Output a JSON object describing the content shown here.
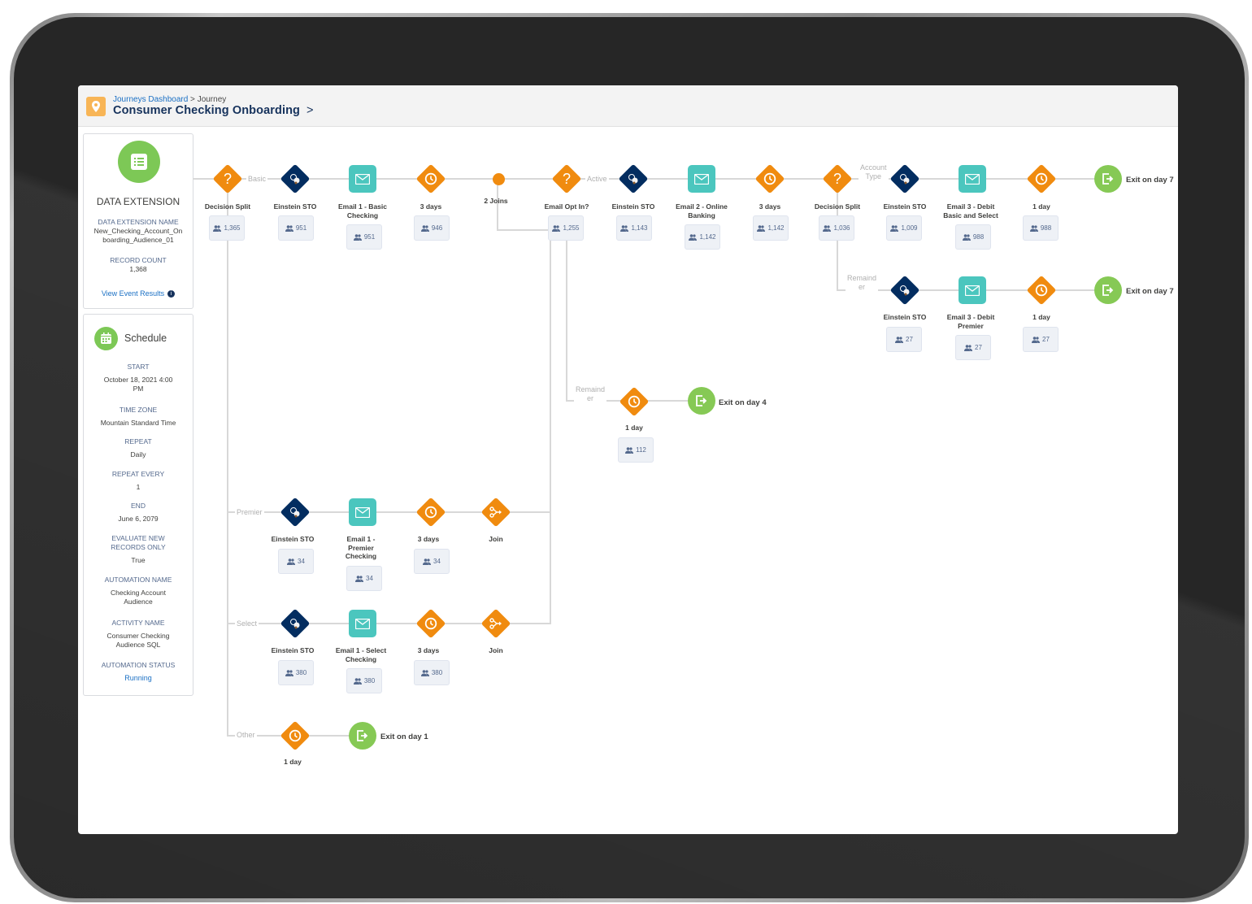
{
  "header": {
    "breadcrumb_link": "Journeys Dashboard",
    "breadcrumb_sep": " > ",
    "breadcrumb_current": "Journey",
    "title": "Consumer Checking Onboarding",
    "title_chevron": ">",
    "icon": "location-pin-icon",
    "icon_color": "#f8b556"
  },
  "data_extension": {
    "heading": "DATA EXTENSION",
    "name_label": "DATA EXTENSION NAME",
    "name_line1": "New_Checking_Account_On",
    "name_line2": "boarding_Audience_01",
    "count_label": "RECORD COUNT",
    "count_value": "1,368",
    "link": "View Event Results",
    "info": "i"
  },
  "schedule": {
    "heading": "Schedule",
    "start_label": "START",
    "start_line1": "October 18, 2021 4:00",
    "start_line2": "PM",
    "tz_label": "TIME ZONE",
    "tz_value": "Mountain Standard Time",
    "repeat_label": "REPEAT",
    "repeat_value": "Daily",
    "every_label": "REPEAT EVERY",
    "every_value": "1",
    "end_label": "END",
    "end_value": "June 6, 2079",
    "eval_label1": "EVALUATE NEW",
    "eval_label2": "RECORDS ONLY",
    "eval_value": "True",
    "auto_label": "AUTOMATION NAME",
    "auto_line1": "Checking Account",
    "auto_line2": "Audience",
    "act_label": "ACTIVITY NAME",
    "act_line1": "Consumer Checking",
    "act_line2": "Audience SQL",
    "status_label": "AUTOMATION STATUS",
    "status_value": "Running"
  },
  "paths": {
    "basic": "Basic",
    "premier": "Premier",
    "select": "Select",
    "other": "Other",
    "active": "Active",
    "remainder1": "Remaind",
    "remainder2": "er",
    "account1": "Account",
    "account2": "Type"
  },
  "nodes": {
    "split1": {
      "label": "Decision Split",
      "count": "1,365"
    },
    "sto_basic": {
      "label": "Einstein STO",
      "count": "951"
    },
    "email1_basic": {
      "label1": "Email 1 - Basic",
      "label2": "Checking",
      "count": "951"
    },
    "wait_basic": {
      "label": "3 days",
      "count": "946"
    },
    "joins": {
      "label": "2 Joins"
    },
    "optin": {
      "label": "Email Opt In?",
      "count": "1,255"
    },
    "sto_active": {
      "label": "Einstein STO",
      "count": "1,143"
    },
    "email2": {
      "label1": "Email 2 - Online",
      "label2": "Banking",
      "count": "1,142"
    },
    "wait_active": {
      "label": "3 days",
      "count": "1,142"
    },
    "split2": {
      "label": "Decision Split",
      "count": "1,036"
    },
    "sto_acct": {
      "label": "Einstein STO",
      "count": "1,009"
    },
    "email3_basic": {
      "label1": "Email 3 - Debit",
      "label2": "Basic and Select",
      "count": "988"
    },
    "wait_acct": {
      "label": "1 day",
      "count": "988"
    },
    "exit_acct": {
      "label": "Exit on day 7"
    },
    "sto_rem": {
      "label": "Einstein STO",
      "count": "27"
    },
    "email3_prem": {
      "label1": "Email 3 - Debit",
      "label2": "Premier",
      "count": "27"
    },
    "wait_rem": {
      "label": "1 day",
      "count": "27"
    },
    "exit_rem": {
      "label": "Exit on day 7"
    },
    "wait_optout": {
      "label": "1 day",
      "count": "112"
    },
    "exit_optout": {
      "label": "Exit on day 4"
    },
    "sto_prem": {
      "label": "Einstein STO",
      "count": "34"
    },
    "email1_prem": {
      "label1": "Email 1 -",
      "label2": "Premier",
      "label3": "Checking",
      "count": "34"
    },
    "wait_prem": {
      "label": "3 days",
      "count": "34"
    },
    "join_prem": {
      "label": "Join"
    },
    "sto_sel": {
      "label": "Einstein STO",
      "count": "380"
    },
    "email1_sel": {
      "label1": "Email 1 - Select",
      "label2": "Checking",
      "count": "380"
    },
    "wait_sel": {
      "label": "3 days",
      "count": "380"
    },
    "join_sel": {
      "label": "Join"
    },
    "wait_other": {
      "label": "1 day"
    },
    "exit_other": {
      "label": "Exit on day 1"
    }
  },
  "colors": {
    "decision": "#f08b0f",
    "einstein": "#032d60",
    "email": "#4bc6be",
    "exit": "#86c955",
    "link": "#1b70c4",
    "title": "#16325c"
  }
}
